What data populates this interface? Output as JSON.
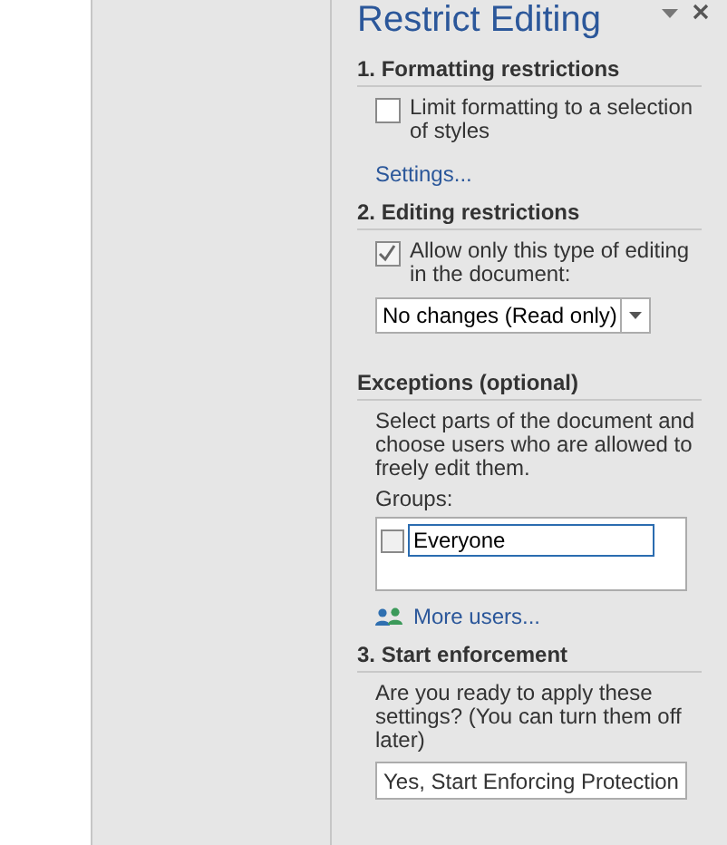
{
  "pane": {
    "title": "Restrict Editing"
  },
  "formatting": {
    "heading": "1. Formatting restrictions",
    "checkbox": {
      "label": "Limit formatting to a selection of styles",
      "checked": false
    },
    "link": "Settings..."
  },
  "editing": {
    "heading": "2. Editing restrictions",
    "checkbox": {
      "label": "Allow only this type of editing in the document:",
      "checked": true
    },
    "dropdown": {
      "value": "No changes (Read only)"
    }
  },
  "exceptions": {
    "heading": "Exceptions (optional)",
    "description": "Select parts of the document and choose users who are allowed to freely edit them.",
    "groups_label": "Groups:",
    "groups": [
      {
        "name": "Everyone",
        "checked": false
      }
    ],
    "link": "More users..."
  },
  "enforcement": {
    "heading": "3. Start enforcement",
    "description": "Are you ready to apply these settings? (You can turn them off later)",
    "button": "Yes, Start Enforcing Protection"
  }
}
